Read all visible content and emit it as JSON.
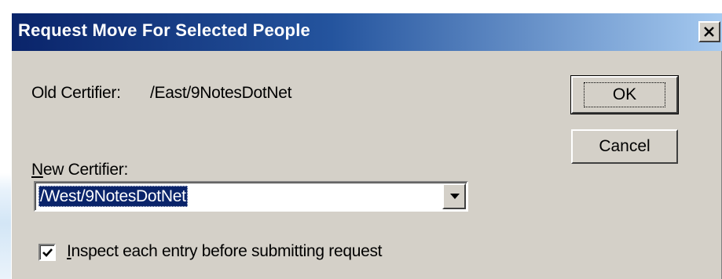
{
  "dialog": {
    "title": "Request Move For Selected People"
  },
  "old_certifier": {
    "label": "Old Certifier:",
    "value": "/East/9NotesDotNet"
  },
  "new_certifier": {
    "label_accel": "N",
    "label_rest": "ew Certifier:",
    "selected_value": "/West/9NotesDotNet"
  },
  "inspect_option": {
    "label_accel": "I",
    "label_rest": "nspect each entry before submitting request",
    "checked": true
  },
  "buttons": {
    "ok_label": "OK",
    "cancel_label": "Cancel"
  },
  "icons": {
    "close": "close-icon",
    "dropdown": "chevron-down-icon",
    "check": "checkmark-icon"
  },
  "colors": {
    "title_start": "#0a246a",
    "title_end": "#a6caf0",
    "face": "#d4d0c8",
    "selection": "#0a246a"
  }
}
